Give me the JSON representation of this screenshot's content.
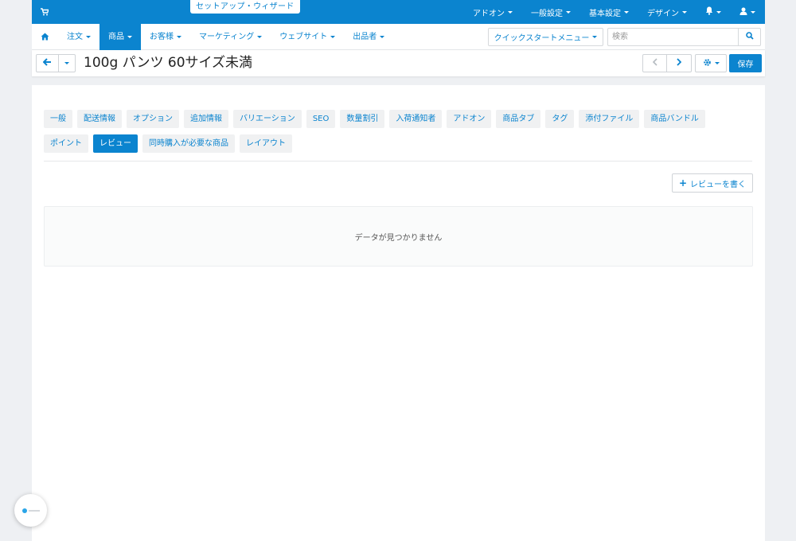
{
  "topbar": {
    "wizard_label": "セットアップ・ウィザード",
    "menu": [
      {
        "label": "アドオン"
      },
      {
        "label": "一般設定"
      },
      {
        "label": "基本設定"
      },
      {
        "label": "デザイン"
      }
    ],
    "icons": [
      "cart-icon",
      "bell-icon",
      "user-icon"
    ]
  },
  "nav": {
    "items": [
      {
        "label": "注文"
      },
      {
        "label": "商品"
      },
      {
        "label": "お客様"
      },
      {
        "label": "マーケティング"
      },
      {
        "label": "ウェブサイト"
      },
      {
        "label": "出品者"
      }
    ],
    "active_item": "商品",
    "quickstart_label": "クイックスタートメニュー",
    "search_placeholder": "検索"
  },
  "titlebar": {
    "title": "100g パンツ 60サイズ未満",
    "save_label": "保存"
  },
  "tabs": [
    {
      "label": "一般"
    },
    {
      "label": "配送情報"
    },
    {
      "label": "オプション"
    },
    {
      "label": "追加情報"
    },
    {
      "label": "バリエーション"
    },
    {
      "label": "SEO"
    },
    {
      "label": "数量割引"
    },
    {
      "label": "入荷通知者"
    },
    {
      "label": "アドオン"
    },
    {
      "label": "商品タブ"
    },
    {
      "label": "タグ"
    },
    {
      "label": "添付ファイル"
    },
    {
      "label": "商品バンドル"
    },
    {
      "label": "ポイント"
    },
    {
      "label": "レビュー"
    },
    {
      "label": "同時購入が必要な商品"
    },
    {
      "label": "レイアウト"
    }
  ],
  "active_tab": "レビュー",
  "reviews": {
    "write_label": "レビューを書く",
    "empty_message": "データが見つかりません"
  },
  "colors": {
    "accent": "#0b84cf",
    "background": "#eef0f3"
  }
}
